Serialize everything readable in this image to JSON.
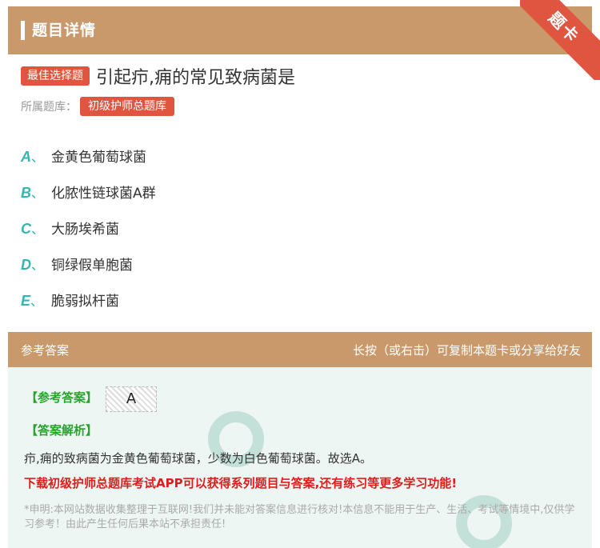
{
  "header": {
    "title": "题目详情",
    "corner_label": "题卡"
  },
  "question": {
    "type_badge": "最佳选择题",
    "text": "引起疖,痈的常见致病菌是",
    "bank_label": "所属题库：",
    "bank_name": "初级护师总题库"
  },
  "options": [
    {
      "letter": "A",
      "sep": "、",
      "text": "金黄色葡萄球菌"
    },
    {
      "letter": "B",
      "sep": "、",
      "text": "化脓性链球菌A群"
    },
    {
      "letter": "C",
      "sep": "、",
      "text": "大肠埃希菌"
    },
    {
      "letter": "D",
      "sep": "、",
      "text": "铜绿假单胞菌"
    },
    {
      "letter": "E",
      "sep": "、",
      "text": "脆弱拟杆菌"
    }
  ],
  "answer": {
    "section_title": "参考答案",
    "copy_hint": "长按（或右击）可复制本题卡或分享给好友",
    "answer_tag": "【参考答案】",
    "answer_value": "A",
    "analysis_tag": "【答案解析】",
    "analysis_text": "疖,痈的致病菌为金黄色葡萄球菌，少数为白色葡萄球菌。故选A。",
    "download_text": "下载初级护师总题库考试APP可以获得系列题目与答案,还有练习等更多学习功能!",
    "disclaimer": "*申明:本网站数据收集整理于互联网!我们并未能对答案信息进行核对!本信息不能用于生产、生活、考试等情境中,仅供学习参考！由此产生任何后果本站不承担责任!"
  },
  "colors": {
    "header_bg": "#c9996b",
    "badge_red": "#e0553f",
    "option_letter": "#35b5b2",
    "answer_green": "#27a52b",
    "download_red": "#e41b1b",
    "answer_bg": "#edf6f3"
  }
}
